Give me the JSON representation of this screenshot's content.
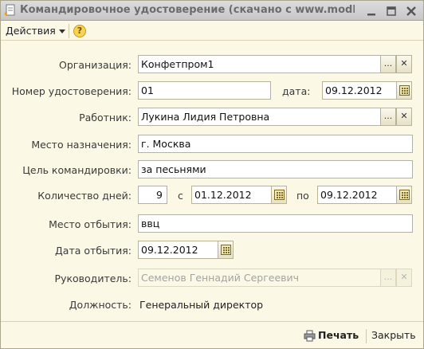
{
  "window": {
    "title": "Командировочное удостоверение (скачано с www.modb..."
  },
  "toolbar": {
    "actions_label": "Действия",
    "help_glyph": "?"
  },
  "form": {
    "organization": {
      "label": "Организация:",
      "value": "Конфетпром1"
    },
    "certificate_number": {
      "label": "Номер удостоверения:",
      "value": "01"
    },
    "date": {
      "label": "дата:",
      "value": "09.12.2012"
    },
    "employee": {
      "label": "Работник:",
      "value": "Лукина  Лидия Петровна"
    },
    "destination": {
      "label": "Место назначения:",
      "value": "г. Москва"
    },
    "purpose": {
      "label": "Цель командировки:",
      "value": "за песьнями"
    },
    "days_count": {
      "label": "Количество дней:",
      "value": "9"
    },
    "from": {
      "label": "с",
      "value": "01.12.2012"
    },
    "to": {
      "label": "по",
      "value": "09.12.2012"
    },
    "departure_place": {
      "label": "Место отбытия:",
      "value": "ввц"
    },
    "departure_date": {
      "label": "Дата отбытия:",
      "value": "09.12.2012"
    },
    "manager": {
      "label": "Руководитель:",
      "value": "Семенов Геннадий Сергеевич"
    },
    "position": {
      "label": "Должность:",
      "value": "Генеральный директор"
    }
  },
  "buttons": {
    "select_glyph": "...",
    "clear_glyph": "✕",
    "print_label": "Печать",
    "close_label": "Закрыть"
  },
  "colors": {
    "form_background": "#fbf8e6",
    "field_border": "#b8b396",
    "disabled_text": "#a3a3a3"
  }
}
